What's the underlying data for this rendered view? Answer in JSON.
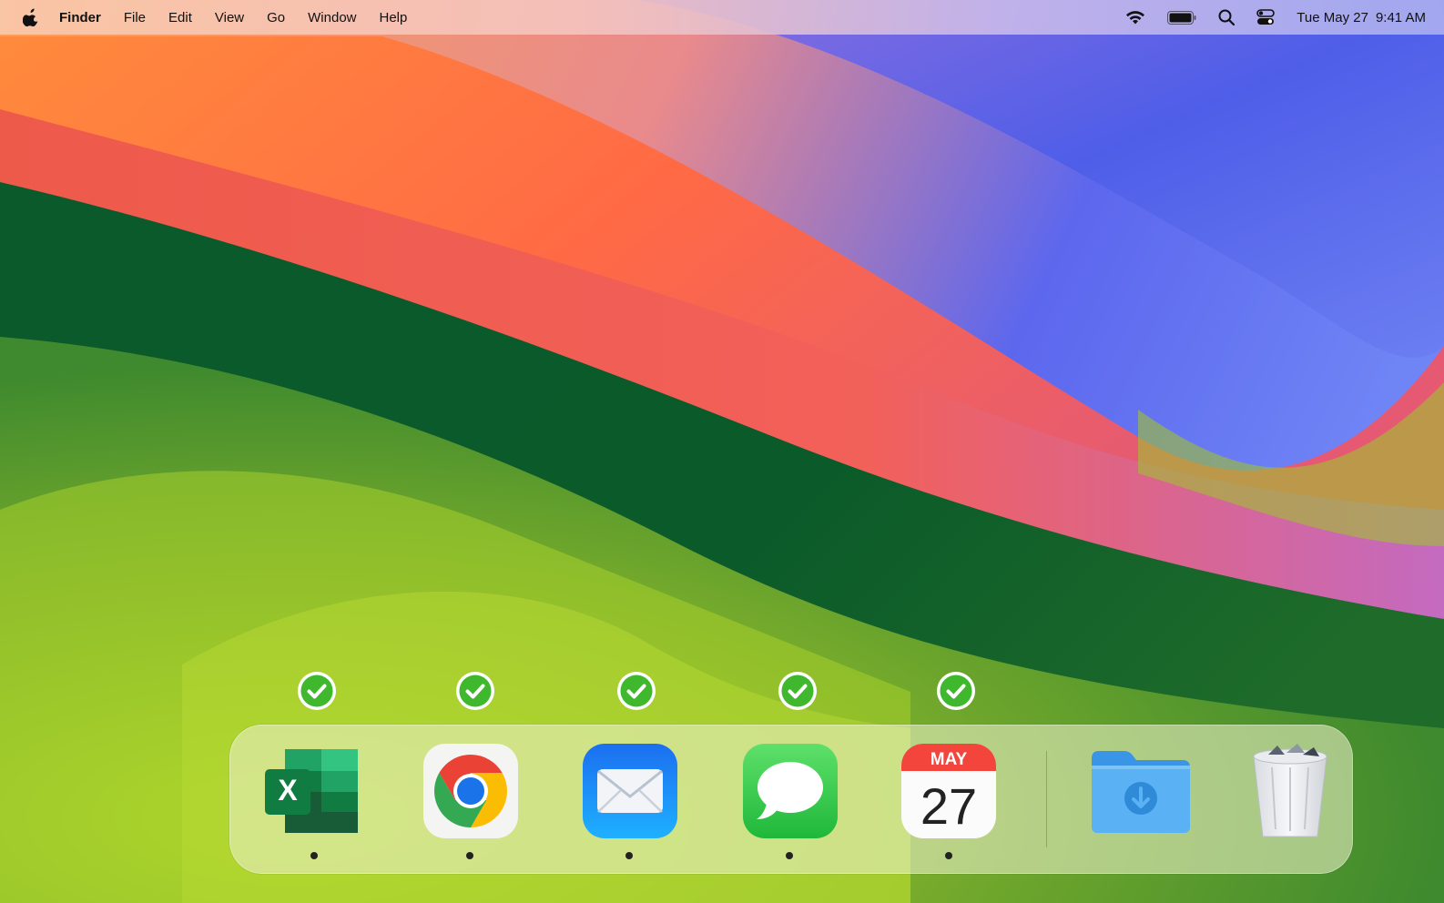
{
  "menubar": {
    "app_name": "Finder",
    "menus": [
      "File",
      "Edit",
      "View",
      "Go",
      "Window",
      "Help"
    ],
    "clock_date": "Tue May 27",
    "clock_time": "9:41 AM",
    "status_icons": [
      "wifi-icon",
      "battery-icon",
      "spotlight-search-icon",
      "control-center-icon"
    ]
  },
  "dock": {
    "apps": [
      {
        "name": "Microsoft Excel",
        "icon": "excel-icon",
        "running": true,
        "selected": true
      },
      {
        "name": "Google Chrome",
        "icon": "chrome-icon",
        "running": true,
        "selected": true
      },
      {
        "name": "Mail",
        "icon": "mail-icon",
        "running": true,
        "selected": true
      },
      {
        "name": "Messages",
        "icon": "messages-icon",
        "running": true,
        "selected": true
      },
      {
        "name": "Calendar",
        "icon": "calendar-icon",
        "running": true,
        "selected": true
      }
    ],
    "calendar": {
      "month": "MAY",
      "day": "27"
    },
    "excel_letter": "X",
    "extras": [
      {
        "name": "Downloads",
        "icon": "downloads-folder-icon"
      },
      {
        "name": "Trash",
        "icon": "trash-icon"
      }
    ]
  },
  "colors": {
    "check_green": "#3fb82e",
    "excel_green": "#1d6f42",
    "mail_blue": "#1a8cff",
    "messages_green": "#2fcb4a",
    "calendar_red": "#f3453c",
    "folder_blue": "#5ab1f3"
  }
}
